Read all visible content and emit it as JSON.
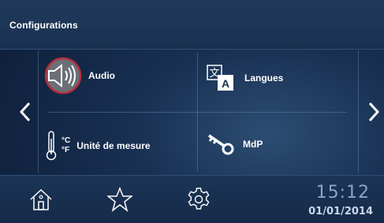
{
  "header": {
    "title": "Configurations"
  },
  "tiles": [
    {
      "label": "Audio",
      "icon": "speaker-icon"
    },
    {
      "label": "Langues",
      "icon": "translate-icon"
    },
    {
      "label": "Unité de mesure",
      "icon": "thermometer-icon",
      "unit_c": "°C",
      "unit_f": "°F"
    },
    {
      "label": "MdP",
      "icon": "key-icon"
    }
  ],
  "nav": {
    "prev_icon": "chevron-left-icon",
    "next_icon": "chevron-right-icon"
  },
  "footer": {
    "buttons": [
      "home-icon",
      "star-icon",
      "gear-icon"
    ],
    "time": "15:12",
    "date": "01/01/2014"
  },
  "colors": {
    "background": "#183052",
    "audio_highlight": "#b5303a",
    "time_text": "#8da5c4"
  }
}
